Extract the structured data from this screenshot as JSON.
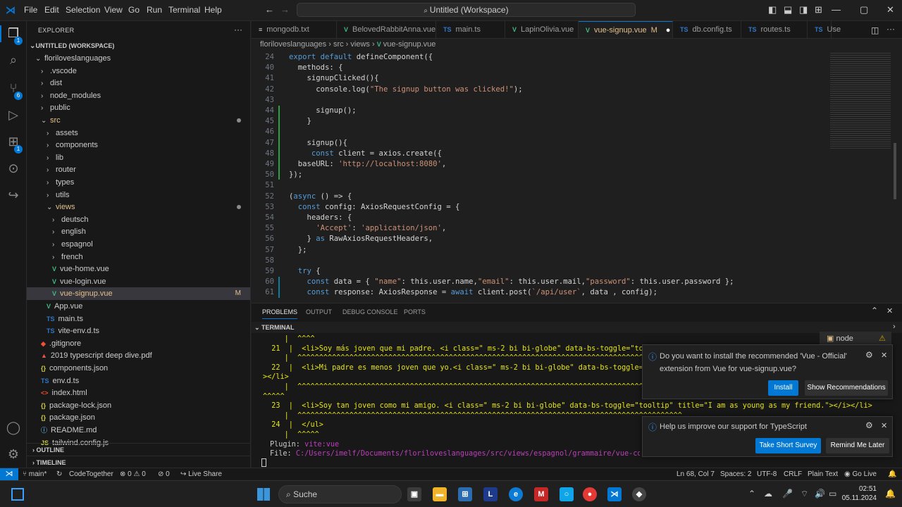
{
  "menu": [
    "File",
    "Edit",
    "Selection",
    "View",
    "Go",
    "Run",
    "Terminal",
    "Help"
  ],
  "command_center": "Untitled (Workspace)",
  "explorer": {
    "title": "EXPLORER",
    "workspace": "UNTITLED (WORKSPACE)",
    "items": [
      {
        "label": "floriloveslanguages",
        "indent": 1,
        "tw": "⌄",
        "color": "#cccccc"
      },
      {
        "label": ".vscode",
        "indent": 2,
        "tw": "›",
        "color": "#cccccc"
      },
      {
        "label": "dist",
        "indent": 2,
        "tw": "›",
        "color": "#cccccc"
      },
      {
        "label": "node_modules",
        "indent": 2,
        "tw": "›",
        "color": "#cccccc"
      },
      {
        "label": "public",
        "indent": 2,
        "tw": "›",
        "color": "#cccccc"
      },
      {
        "label": "src",
        "indent": 2,
        "tw": "⌄",
        "color": "#e2c08d",
        "dot": true
      },
      {
        "label": "assets",
        "indent": 3,
        "tw": "›",
        "color": "#cccccc"
      },
      {
        "label": "components",
        "indent": 3,
        "tw": "›",
        "color": "#cccccc"
      },
      {
        "label": "lib",
        "indent": 3,
        "tw": "›",
        "color": "#cccccc"
      },
      {
        "label": "router",
        "indent": 3,
        "tw": "›",
        "color": "#cccccc"
      },
      {
        "label": "types",
        "indent": 3,
        "tw": "›",
        "color": "#cccccc"
      },
      {
        "label": "utils",
        "indent": 3,
        "tw": "›",
        "color": "#cccccc"
      },
      {
        "label": "views",
        "indent": 3,
        "tw": "⌄",
        "color": "#e2c08d",
        "dot": true
      },
      {
        "label": "deutsch",
        "indent": 4,
        "tw": "›",
        "color": "#cccccc"
      },
      {
        "label": "english",
        "indent": 4,
        "tw": "›",
        "color": "#cccccc"
      },
      {
        "label": "espagnol",
        "indent": 4,
        "tw": "›",
        "color": "#cccccc"
      },
      {
        "label": "french",
        "indent": 4,
        "tw": "›",
        "color": "#cccccc"
      },
      {
        "label": "vue-home.vue",
        "indent": 4,
        "icon": "V",
        "iconColor": "#41b883",
        "color": "#cccccc"
      },
      {
        "label": "vue-login.vue",
        "indent": 4,
        "icon": "V",
        "iconColor": "#41b883",
        "color": "#cccccc"
      },
      {
        "label": "vue-signup.vue",
        "indent": 4,
        "icon": "V",
        "iconColor": "#41b883",
        "color": "#e2c08d",
        "sel": true,
        "flag": "M"
      },
      {
        "label": "App.vue",
        "indent": 3,
        "icon": "V",
        "iconColor": "#41b883",
        "color": "#cccccc"
      },
      {
        "label": "main.ts",
        "indent": 3,
        "icon": "TS",
        "iconColor": "#3178c6",
        "color": "#cccccc"
      },
      {
        "label": "vite-env.d.ts",
        "indent": 3,
        "icon": "TS",
        "iconColor": "#3178c6",
        "color": "#cccccc"
      },
      {
        "label": ".gitignore",
        "indent": 2,
        "icon": "◆",
        "iconColor": "#f05133",
        "color": "#cccccc"
      },
      {
        "label": "2019 typescript deep dive.pdf",
        "indent": 2,
        "icon": "▲",
        "iconColor": "#e5534b",
        "color": "#cccccc"
      },
      {
        "label": "components.json",
        "indent": 2,
        "icon": "{}",
        "iconColor": "#cbcb41",
        "color": "#cccccc"
      },
      {
        "label": "env.d.ts",
        "indent": 2,
        "icon": "TS",
        "iconColor": "#3178c6",
        "color": "#cccccc"
      },
      {
        "label": "index.html",
        "indent": 2,
        "icon": "<>",
        "iconColor": "#e44d26",
        "color": "#cccccc"
      },
      {
        "label": "package-lock.json",
        "indent": 2,
        "icon": "{}",
        "iconColor": "#cbcb41",
        "color": "#cccccc"
      },
      {
        "label": "package.json",
        "indent": 2,
        "icon": "{}",
        "iconColor": "#cbcb41",
        "color": "#cccccc"
      },
      {
        "label": "README.md",
        "indent": 2,
        "icon": "ⓘ",
        "iconColor": "#519aba",
        "color": "#cccccc"
      },
      {
        "label": "tailwind.config.js",
        "indent": 2,
        "icon": "JS",
        "iconColor": "#cbcb41",
        "color": "#cccccc"
      }
    ],
    "outline": "OUTLINE",
    "timeline": "TIMELINE"
  },
  "tabs": [
    {
      "label": "mongodb.txt",
      "icon": "≡",
      "iconColor": "#cccccc"
    },
    {
      "label": "BelovedRabbitAnna.vue",
      "icon": "V",
      "iconColor": "#41b883"
    },
    {
      "label": "main.ts",
      "icon": "TS",
      "iconColor": "#3178c6"
    },
    {
      "label": "LapinOlivia.vue",
      "icon": "V",
      "iconColor": "#41b883"
    },
    {
      "label": "vue-signup.vue",
      "icon": "V",
      "iconColor": "#41b883",
      "active": true,
      "flag": "M"
    },
    {
      "label": "db.config.ts",
      "icon": "TS",
      "iconColor": "#3178c6"
    },
    {
      "label": "routes.ts",
      "icon": "TS",
      "iconColor": "#3178c6"
    },
    {
      "label": "Use",
      "icon": "TS",
      "iconColor": "#3178c6"
    }
  ],
  "breadcrumb": [
    "floriloveslanguages",
    "src",
    "views",
    "vue-signup.vue"
  ],
  "code_lines": [
    {
      "n": "24",
      "t": "export default defineComponent({"
    },
    {
      "n": "40",
      "t": "  methods: {"
    },
    {
      "n": "41",
      "t": "    signupClicked(){"
    },
    {
      "n": "42",
      "t": "      console.log(\"The signup button was clicked!\");"
    },
    {
      "n": "43",
      "t": ""
    },
    {
      "n": "44",
      "t": "      signup();"
    },
    {
      "n": "45",
      "t": "    }"
    },
    {
      "n": "46",
      "t": ""
    },
    {
      "n": "47",
      "t": "    signup(){"
    },
    {
      "n": "48",
      "t": "     const client = axios.create({"
    },
    {
      "n": "49",
      "t": "  baseURL: 'http://localhost:8080',"
    },
    {
      "n": "50",
      "t": "});"
    },
    {
      "n": "51",
      "t": ""
    },
    {
      "n": "52",
      "t": "(async () => {"
    },
    {
      "n": "53",
      "t": "  const config: AxiosRequestConfig = {"
    },
    {
      "n": "54",
      "t": "    headers: {"
    },
    {
      "n": "55",
      "t": "      'Accept': 'application/json',"
    },
    {
      "n": "56",
      "t": "    } as RawAxiosRequestHeaders,"
    },
    {
      "n": "57",
      "t": "  };"
    },
    {
      "n": "58",
      "t": ""
    },
    {
      "n": "59",
      "t": "  try {"
    },
    {
      "n": "60",
      "t": "    const data = { \"name\": this.user.name,\"email\": this.user.mail,\"password\": this.user.password };"
    },
    {
      "n": "61",
      "t": "    const response: AxiosResponse = await client.post(`/api/user`, data , config);"
    }
  ],
  "panel_tabs": [
    "PROBLEMS",
    "OUTPUT",
    "DEBUG CONSOLE",
    "PORTS"
  ],
  "terminal_title": "TERMINAL",
  "terminal_node": "node",
  "terminal_lines": [
    {
      "t": "     |  ^^^^",
      "c": "#e5e510"
    },
    {
      "t": "  21  |  <li>Soy más joven que mi padre. <i class=\" ms-2 bi bi-globe\" data-bs-toggle=\"tooltip\" titl",
      "c": "#e5e510"
    },
    {
      "t": "     |  ^^^^^^^^^^^^^^^^^^^^^^^^^^^^^^^^^^^^^^^^^^^^^^^^^^^^^^^^^^^^^^^^^^^^^^^^^^^^^^^^^^^^^^^^^^",
      "c": "#e5e510"
    },
    {
      "t": "  22  |  <li>Mi padre es menos joven que yo.<i class=\" ms-2 bi bi-globe\" data-bs-toggle=\"tooltip\" t",
      "c": "#e5e510"
    },
    {
      "t": "></li>",
      "c": "#e5e510"
    },
    {
      "t": "     |  ^^^^^^^^^^^^^^^^^^^^^^^^^^^^^^^^^^^^^^^^^^^^^^^^^^^^^^^^^^^^^^^^^^^^^^^^^^^^^^^^^^^^^^^^^",
      "c": "#e5e510"
    },
    {
      "t": "^^^^^",
      "c": "#e5e510"
    },
    {
      "t": "  23  |  <li>Soy tan joven como mi amigo. <i class=\" ms-2 bi bi-globe\" data-bs-toggle=\"tooltip\" title=\"I am as young as my friend.\"></i></li>",
      "c": "#e5e510"
    },
    {
      "t": "     |  ^^^^^^^^^^^^^^^^^^^^^^^^^^^^^^^^^^^^^^^^^^^^^^^^^^^^^^^^^^^^^^^^^^^^^^^^^^^^^^^^^^^^^^^^^",
      "c": "#e5e510"
    },
    {
      "t": "  24  |  </ul>",
      "c": "#e5e510"
    },
    {
      "t": "     |  ^^^^^",
      "c": "#e5e510"
    }
  ],
  "terminal_plugin_label": "Plugin:",
  "terminal_plugin_value": "vite:vue",
  "terminal_file_label": "File:",
  "terminal_file_value": "C:/Users/imelf/Documents/floriloveslanguages/src/views/espagnol/grammaire/vue-comparatif",
  "notifications": [
    {
      "text": "Do you want to install the recommended 'Vue - Official' extension from Vue for vue-signup.vue?",
      "primary": "Install",
      "secondary": "Show Recommendations"
    },
    {
      "text": "Help us improve our support for TypeScript",
      "primary": "Take Short Survey",
      "secondary": "Remind Me Later"
    }
  ],
  "status": {
    "branch": "main*",
    "codetogether": "CodeTogether",
    "errors": "0",
    "warnings": "0",
    "ports": "0",
    "liveshare": "Live Share",
    "position": "Ln 68, Col 7",
    "spaces": "Spaces: 2",
    "encoding": "UTF-8",
    "eol": "CRLF",
    "language": "Plain Text",
    "golive": "Go Live"
  },
  "taskbar": {
    "search": "Suche",
    "time": "02:51",
    "date": "05.11.2024"
  },
  "colors": {
    "accent": "#0078d4",
    "statusbar": "#181818",
    "keyword": "#569cd6",
    "string": "#ce9178"
  }
}
